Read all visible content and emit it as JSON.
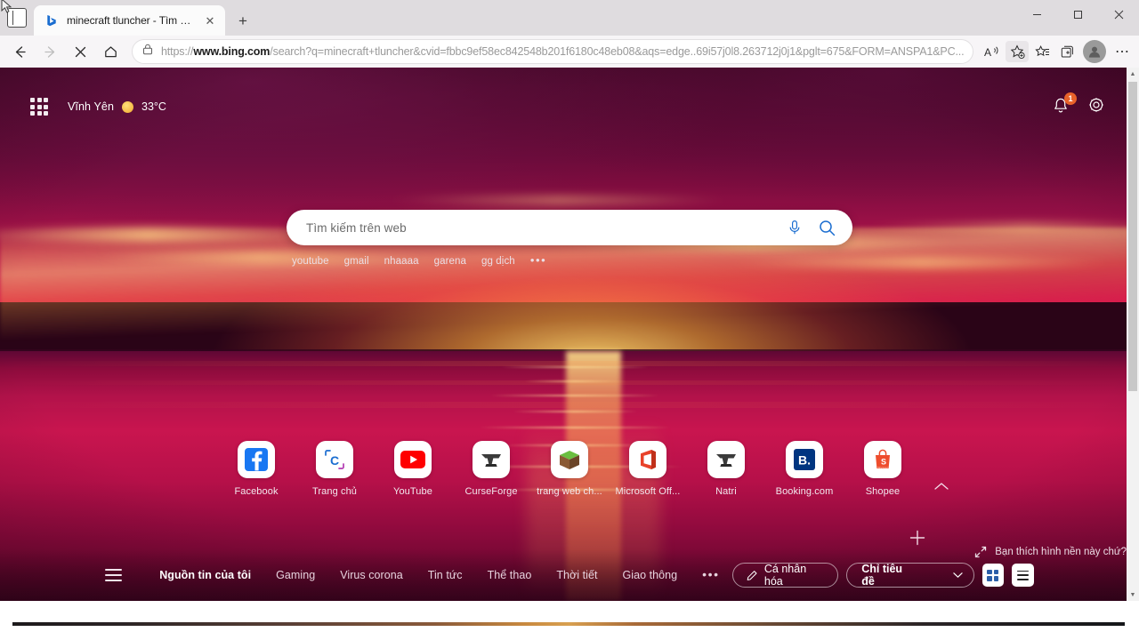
{
  "browser": {
    "tab": {
      "title": "minecraft tluncher - Tìm kiếm",
      "close_label": "✕",
      "favicon_name": "bing-favicon"
    },
    "new_tab_label": "+",
    "window_controls": {
      "minimize": "—",
      "maximize": "▢",
      "close": "✕"
    },
    "nav": {
      "back": "←",
      "forward": "→",
      "stop": "✕",
      "home": "⌂"
    },
    "omnibox": {
      "lock": "🔒",
      "url_prefix": "https://",
      "url_domain": "www.bing.com",
      "url_rest": "/search?q=minecraft+tluncher&cvid=fbbc9ef58ec842548b201f6180c48eb08&aqs=edge..69i57j0l8.263712j0j1&pglt=675&FORM=ANSPA1&PC...",
      "read_aloud": "read-aloud",
      "add_collection": "add-to-favorites",
      "favorites": "favorites",
      "collections": "collections",
      "profile": "profile",
      "settings_more": "⋯"
    }
  },
  "ntp": {
    "top": {
      "apps_label": "waffle-apps",
      "location": "Vĩnh Yên",
      "temperature": "33°C",
      "notifications_badge": "1",
      "notifications_label": "notifications",
      "settings_label": "page-settings"
    },
    "search": {
      "placeholder": "Tìm kiếm trên web",
      "mic_label": "microphone",
      "search_label": "search"
    },
    "quick_links": [
      "youtube",
      "gmail",
      "nhaaaa",
      "garena",
      "gg dịch"
    ],
    "quick_links_more": "•••",
    "shortcuts": [
      {
        "label": "Facebook",
        "icon": "facebook-icon"
      },
      {
        "label": "Trang chủ",
        "icon": "msn-home-icon"
      },
      {
        "label": "YouTube",
        "icon": "youtube-icon"
      },
      {
        "label": "CurseForge",
        "icon": "curseforge-icon"
      },
      {
        "label": "trang web ch...",
        "icon": "minecraft-icon"
      },
      {
        "label": "Microsoft Off...",
        "icon": "microsoft-office-icon"
      },
      {
        "label": "Natri",
        "icon": "curseforge-icon"
      },
      {
        "label": "Booking.com",
        "icon": "booking-icon"
      },
      {
        "label": "Shopee",
        "icon": "shopee-icon"
      }
    ],
    "add_shortcut_label": "+",
    "collapse_label": "collapse-chevron",
    "wallpaper_hint": "Bạn thích hình nền này chứ?",
    "feed": {
      "menu_label": "feed-menu",
      "nav": [
        {
          "label": "Nguồn tin của tôi",
          "active": true
        },
        {
          "label": "Gaming",
          "active": false
        },
        {
          "label": "Virus corona",
          "active": false
        },
        {
          "label": "Tin tức",
          "active": false
        },
        {
          "label": "Thể thao",
          "active": false
        },
        {
          "label": "Thời tiết",
          "active": false
        },
        {
          "label": "Giao thông",
          "active": false
        }
      ],
      "more": "•••",
      "personalize": "Cá nhân hóa",
      "layout_select": "Chỉ tiêu đề",
      "view_grid": "grid-view",
      "view_list": "list-view"
    }
  },
  "colors": {
    "accent_orange": "#e8622a",
    "sky_deep": "#3a0520",
    "sea": "#c9154f",
    "sun": "#ffd064",
    "chrome_bg": "#f7f5f7"
  }
}
